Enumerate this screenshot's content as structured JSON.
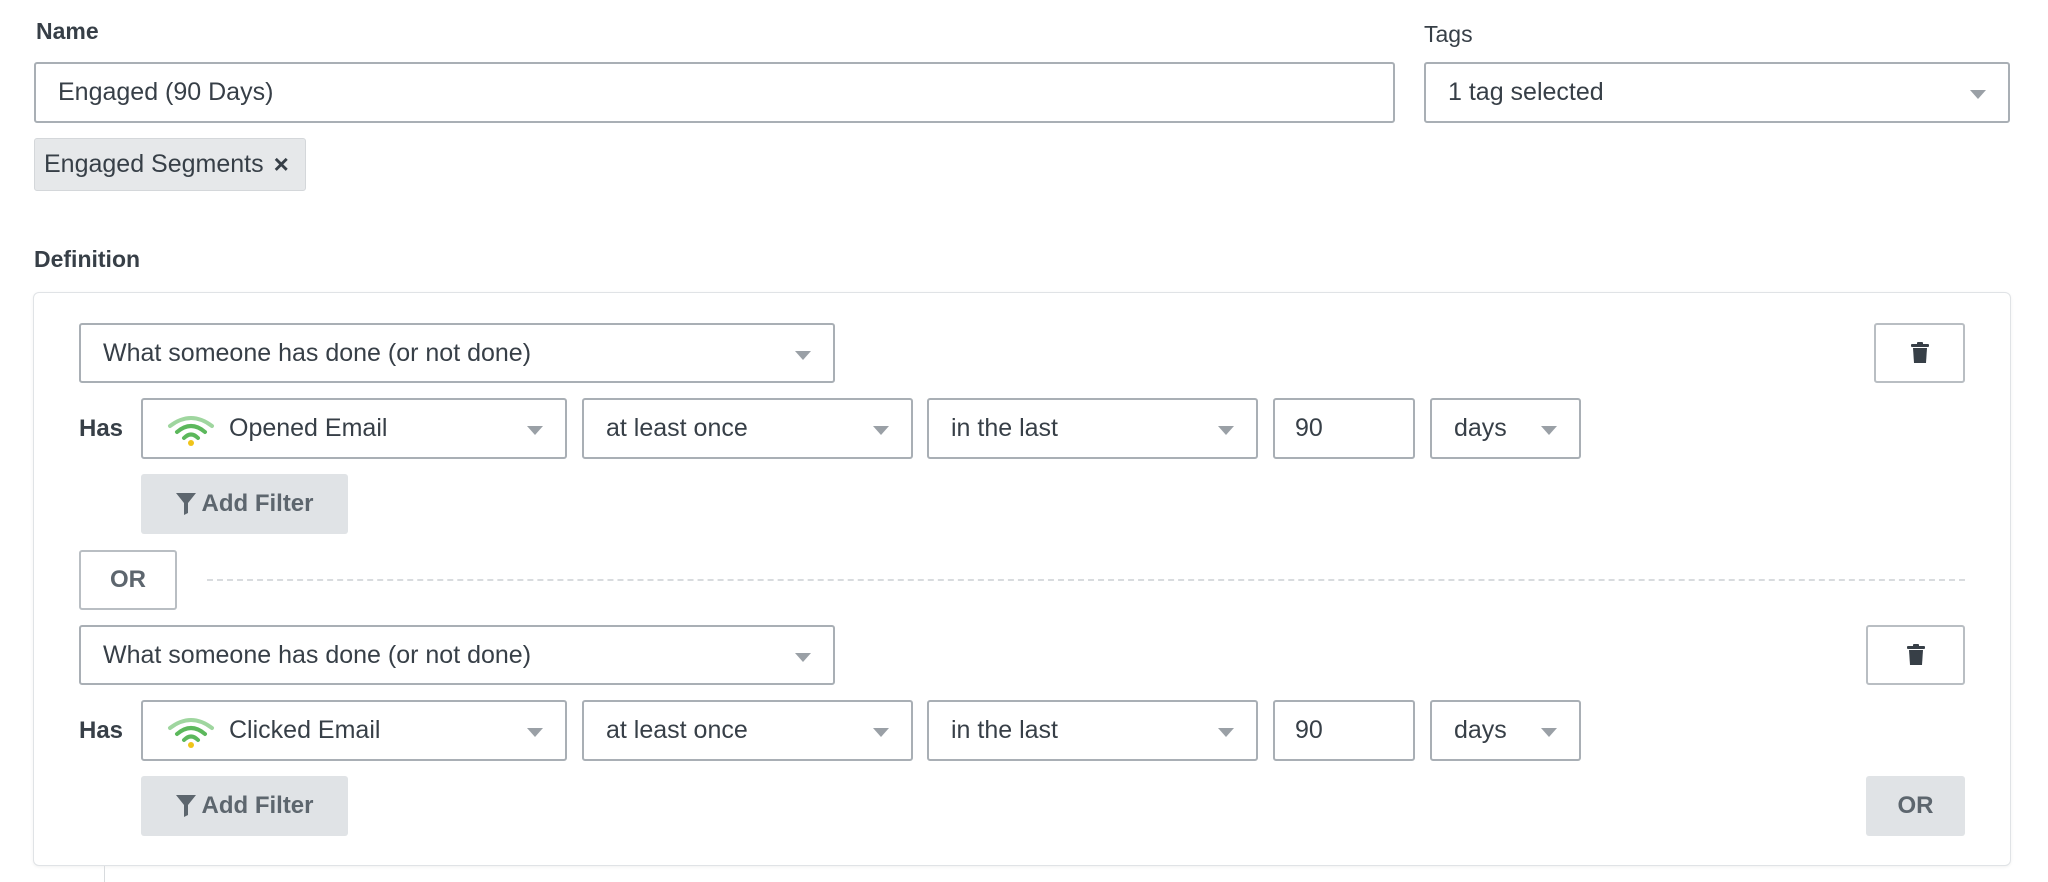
{
  "name_field": {
    "label": "Name",
    "value": "Engaged (90 Days)"
  },
  "tags_field": {
    "label": "Tags",
    "value": "1 tag selected",
    "chips": [
      "Engaged Segments"
    ]
  },
  "definition": {
    "label": "Definition",
    "conditions": [
      {
        "type_select": "What someone has done (or not done)",
        "has_label": "Has",
        "metric": "Opened Email",
        "frequency": "at least once",
        "timeframe": "in the last",
        "amount": "90",
        "unit": "days",
        "add_filter_label": "Add Filter"
      },
      {
        "type_select": "What someone has done (or not done)",
        "has_label": "Has",
        "metric": "Clicked Email",
        "frequency": "at least once",
        "timeframe": "in the last",
        "amount": "90",
        "unit": "days",
        "add_filter_label": "Add Filter"
      }
    ],
    "or_separator_label": "OR",
    "add_or_label": "OR"
  },
  "colors": {
    "metric_icon_green": "#5cb85c",
    "metric_icon_light": "#9fd69f",
    "metric_icon_dot": "#f0c419",
    "button_gray": "#e0e3e6",
    "border": "#a9afb5"
  },
  "icons": {
    "trash": "trash-icon",
    "funnel": "funnel-icon",
    "metric": "klaviyo-metric-icon",
    "remove": "close-icon",
    "dropdown": "chevron-down-icon"
  }
}
